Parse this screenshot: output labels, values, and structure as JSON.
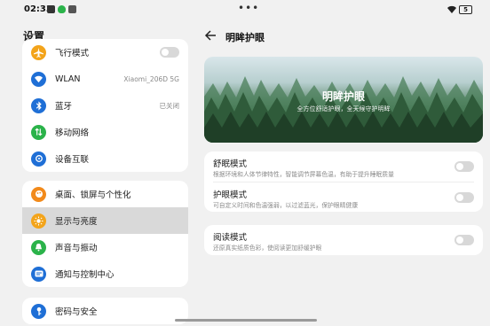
{
  "status": {
    "time": "02:33",
    "battery": "5"
  },
  "colors": {
    "accent": "#1f6fd6",
    "amber": "#f3a41b",
    "green": "#2bb34a",
    "orange": "#f28a1b"
  },
  "left": {
    "title": "设置",
    "group1": [
      {
        "label": "飞行模式",
        "icon": "airplane-icon",
        "value": ""
      },
      {
        "label": "WLAN",
        "icon": "wifi-icon",
        "value": "Xiaomi_206D 5G"
      },
      {
        "label": "蓝牙",
        "icon": "bluetooth-icon",
        "value": "已关闭"
      },
      {
        "label": "移动网络",
        "icon": "mobile-network-icon",
        "value": ""
      },
      {
        "label": "设备互联",
        "icon": "device-connect-icon",
        "value": ""
      }
    ],
    "group2": [
      {
        "label": "桌面、锁屏与个性化",
        "icon": "palette-icon"
      },
      {
        "label": "显示与亮度",
        "icon": "brightness-icon"
      },
      {
        "label": "声音与振动",
        "icon": "bell-icon"
      },
      {
        "label": "通知与控制中心",
        "icon": "notification-icon"
      }
    ],
    "group3": [
      {
        "label": "密码与安全",
        "icon": "key-icon"
      }
    ]
  },
  "right": {
    "title": "明眸护眼",
    "banner": {
      "title": "明眸护眼",
      "subtitle": "全方位舒适护眼，全天候守护明眸"
    },
    "modes": [
      {
        "title": "舒眠模式",
        "desc": "根据环境和人体节律特性，智能调节屏幕色温，有助于提升睡眠质量"
      },
      {
        "title": "护眼模式",
        "desc": "可自定义时间和色温强弱，以过滤蓝光，保护眼睛健康"
      }
    ],
    "reading": {
      "title": "阅读模式",
      "desc": "还原真实纸质色彩，使阅读更加舒缓护眼"
    }
  }
}
